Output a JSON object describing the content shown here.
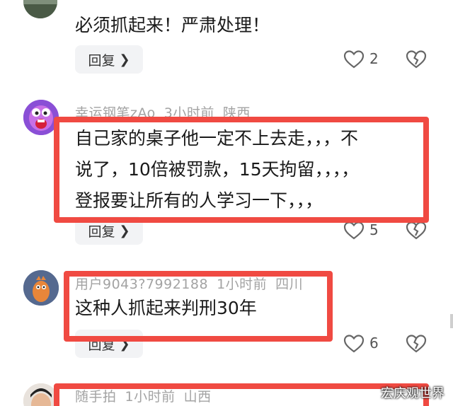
{
  "comments": [
    {
      "username": "",
      "time": "",
      "location": "",
      "text_lines": [
        "必须抓起来！严肃处理！"
      ],
      "reply_label": "回复",
      "likes": "2"
    },
    {
      "username": "幸运钢笔zAo",
      "time": "3小时前",
      "location": "陕西",
      "text_lines": [
        "自己家的桌子他一定不上去走，，，不",
        "说了，10倍被罚款，15天拘留，，，，",
        "登报要让所有的人学习一下，，，"
      ],
      "reply_label": "回复",
      "likes": "5"
    },
    {
      "username": "用户9043?7992188",
      "time": "1小时前",
      "location": "四川",
      "text_lines": [
        "这种人抓起来判刑30年"
      ],
      "reply_label": "回复",
      "likes": "6"
    },
    {
      "username": "随手拍",
      "time": "1小时前",
      "location": "山西",
      "text_lines": [],
      "reply_label": "",
      "likes": ""
    }
  ],
  "icons": {
    "like": "heart-icon",
    "dislike": "broken-heart-icon",
    "reply_arrow": "chevron-right-icon"
  },
  "colors": {
    "highlight_frame": "#f04a42",
    "reply_bg": "#f2f3f5",
    "meta_text": "#a3a3a3"
  },
  "watermark": "宏庆观世界"
}
